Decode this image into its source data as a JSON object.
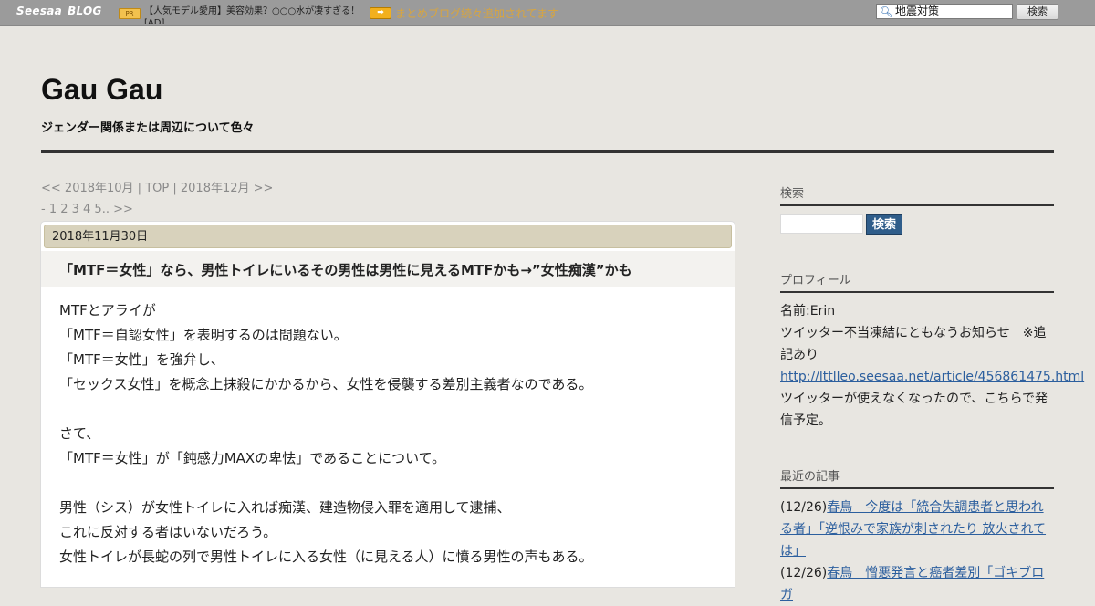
{
  "topbar": {
    "logo": "Seesaa",
    "logo_sub": "BLOG",
    "pr_badge": "PR",
    "ad_text": "【人気モデル愛用】美容効果？○○○水が凄すぎる！[AD]",
    "arrow_badge": "➡",
    "matome_link": "まとめブログ続々追加されてます",
    "search_value": "地震対策",
    "search_button": "検索"
  },
  "header": {
    "title": "Gau Gau",
    "description": "ジェンダー関係または周辺について色々"
  },
  "month_nav": {
    "prev": "<< 2018年10月",
    "sep1": " | ",
    "top": "TOP",
    "sep2": " | ",
    "next": "2018年12月 >>"
  },
  "page_nav": "- 1 2 3 4 5.. >>",
  "article": {
    "date": "2018年11月30日",
    "title": "「MTF＝女性」なら、男性トイレにいるその男性は男性に見えるMTFかも→”女性痴漢”かも",
    "lines": [
      "MTFとアライが",
      "「MTF＝自認女性」を表明するのは問題ない。",
      "「MTF＝女性」を強弁し、",
      "「セックス女性」を概念上抹殺にかかるから、女性を侵襲する差別主義者なのである。",
      "",
      "さて、",
      "「MTF＝女性」が「鈍感力MAXの卑怯」であることについて。",
      "",
      "男性（シス）が女性トイレに入れば痴漢、建造物侵入罪を適用して逮捕、",
      "これに反対する者はいないだろう。",
      "女性トイレが長蛇の列で男性トイレに入る女性（に見える人）に憤る男性の声もある。"
    ]
  },
  "sidebar": {
    "search": {
      "heading": "検索",
      "button": "検索"
    },
    "profile": {
      "heading": "プロフィール",
      "name": "名前:Erin",
      "notice": "ツイッター不当凍結にともなうお知らせ　※追記あり",
      "link": "http://lttlleo.seesaa.net/article/456861475.html",
      "note": "ツイッターが使えなくなったので、こちらで発信予定。"
    },
    "recent": {
      "heading": "最近の記事",
      "items": [
        {
          "date": "(12/26)",
          "title": "春鳥　今度は「統合失調患者と思われる者」「逆恨みで家族が刺されたり 放火されては」"
        },
        {
          "date": "(12/26)",
          "title": "春鳥　憎悪発言と癌者差別「ゴキブロガ"
        }
      ]
    }
  }
}
